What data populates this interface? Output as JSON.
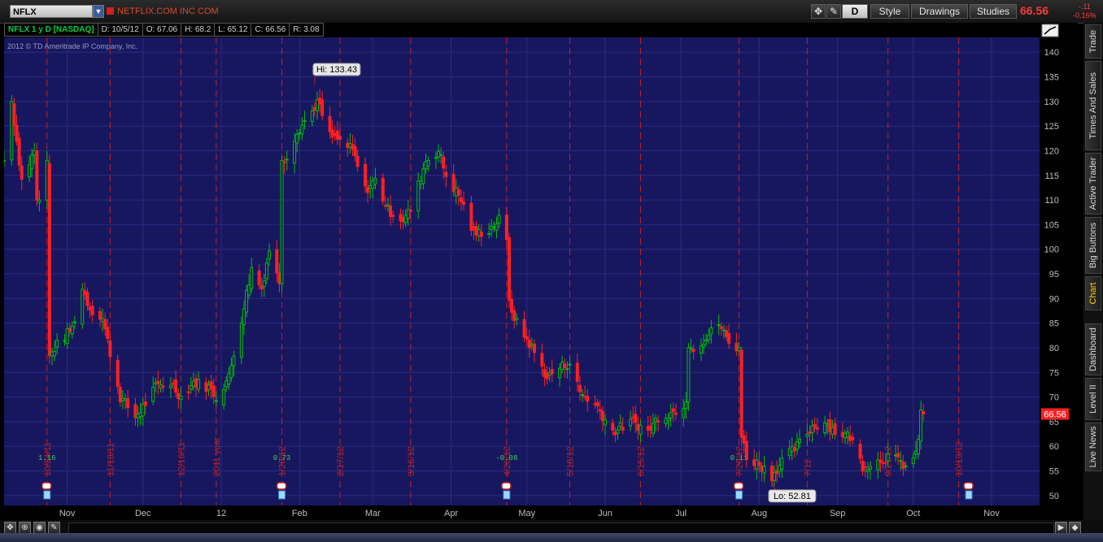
{
  "header": {
    "symbol": "NFLX",
    "company": "NETFLIX.COM INC COM",
    "period_button": "D",
    "style_label": "Style",
    "drawings_label": "Drawings",
    "studies_label": "Studies",
    "last_price": "66.56",
    "net_change": "-.11",
    "pct_change": "-0.16%"
  },
  "info_bar": {
    "title": "NFLX 1 y D [NASDAQ]",
    "date": "D: 10/5/12",
    "open": "O: 67.06",
    "high": "H: 68.2",
    "low": "L: 65.12",
    "close": "C: 66.56",
    "range": "R: 3.08"
  },
  "copyright": "2012 © TD Ameritrade IP Company, Inc.",
  "side_tabs": [
    "Trade",
    "Times And Sales",
    "Active Trader",
    "Big Buttons",
    "Chart",
    "Dashboard",
    "Level II",
    "Live News"
  ],
  "colors": {
    "background": "#171760",
    "grid": "#2b2b80",
    "up_candle": "#00c000",
    "down_candle": "#ff2020",
    "event_line": "#c02020",
    "price_tag_bg": "#ff2020",
    "accent": "#ffcc00"
  },
  "chart_data": {
    "type": "candlestick",
    "title": "NFLX 1 y D [NASDAQ]",
    "ylim": [
      48,
      143
    ],
    "y_ticks": [
      50,
      55,
      60,
      65,
      70,
      75,
      80,
      85,
      90,
      95,
      100,
      105,
      110,
      115,
      120,
      125,
      130,
      135,
      140
    ],
    "x_range": [
      "2011-10-07",
      "2012-11-20"
    ],
    "x_ticks": [
      {
        "date": "2011-11-01",
        "label": "Nov"
      },
      {
        "date": "2011-12-01",
        "label": "Dec"
      },
      {
        "date": "2012-01-01",
        "label": "12"
      },
      {
        "date": "2012-02-01",
        "label": "Feb"
      },
      {
        "date": "2012-03-01",
        "label": "Mar"
      },
      {
        "date": "2012-04-01",
        "label": "Apr"
      },
      {
        "date": "2012-05-01",
        "label": "May"
      },
      {
        "date": "2012-06-01",
        "label": "Jun"
      },
      {
        "date": "2012-07-01",
        "label": "Jul"
      },
      {
        "date": "2012-08-01",
        "label": "Aug"
      },
      {
        "date": "2012-09-01",
        "label": "Sep"
      },
      {
        "date": "2012-10-01",
        "label": "Oct"
      },
      {
        "date": "2012-11-01",
        "label": "Nov"
      }
    ],
    "price_path": [
      {
        "date": "2011-10-07",
        "close": 118
      },
      {
        "date": "2011-10-10",
        "close": 130
      },
      {
        "date": "2011-10-14",
        "close": 114
      },
      {
        "date": "2011-10-19",
        "close": 120
      },
      {
        "date": "2011-10-21",
        "close": 110
      },
      {
        "date": "2011-10-24",
        "close": 118
      },
      {
        "date": "2011-10-25",
        "close": 78
      },
      {
        "date": "2011-10-27",
        "close": 80
      },
      {
        "date": "2011-11-03",
        "close": 84
      },
      {
        "date": "2011-11-07",
        "close": 92
      },
      {
        "date": "2011-11-10",
        "close": 88
      },
      {
        "date": "2011-11-15",
        "close": 86
      },
      {
        "date": "2011-11-18",
        "close": 79
      },
      {
        "date": "2011-11-22",
        "close": 70
      },
      {
        "date": "2011-11-28",
        "close": 66
      },
      {
        "date": "2011-12-01",
        "close": 68
      },
      {
        "date": "2011-12-06",
        "close": 72
      },
      {
        "date": "2011-12-12",
        "close": 73
      },
      {
        "date": "2011-12-16",
        "close": 70
      },
      {
        "date": "2011-12-21",
        "close": 73
      },
      {
        "date": "2011-12-27",
        "close": 72
      },
      {
        "date": "2011-12-30",
        "close": 70
      },
      {
        "date": "2012-01-04",
        "close": 74
      },
      {
        "date": "2012-01-09",
        "close": 86
      },
      {
        "date": "2012-01-13",
        "close": 96
      },
      {
        "date": "2012-01-17",
        "close": 92
      },
      {
        "date": "2012-01-20",
        "close": 100
      },
      {
        "date": "2012-01-24",
        "close": 93
      },
      {
        "date": "2012-01-26",
        "close": 118
      },
      {
        "date": "2012-01-31",
        "close": 124
      },
      {
        "date": "2012-02-06",
        "close": 128
      },
      {
        "date": "2012-02-08",
        "close": 130
      },
      {
        "date": "2012-02-13",
        "close": 123
      },
      {
        "date": "2012-02-17",
        "close": 122
      },
      {
        "date": "2012-02-22",
        "close": 120
      },
      {
        "date": "2012-02-27",
        "close": 112
      },
      {
        "date": "2012-03-02",
        "close": 114
      },
      {
        "date": "2012-03-07",
        "close": 108
      },
      {
        "date": "2012-03-13",
        "close": 106
      },
      {
        "date": "2012-03-16",
        "close": 108
      },
      {
        "date": "2012-03-22",
        "close": 118
      },
      {
        "date": "2012-03-27",
        "close": 120
      },
      {
        "date": "2012-03-30",
        "close": 115
      },
      {
        "date": "2012-04-05",
        "close": 110
      },
      {
        "date": "2012-04-10",
        "close": 103
      },
      {
        "date": "2012-04-16",
        "close": 104
      },
      {
        "date": "2012-04-20",
        "close": 106
      },
      {
        "date": "2012-04-23",
        "close": 102
      },
      {
        "date": "2012-04-24",
        "close": 89
      },
      {
        "date": "2012-04-27",
        "close": 85
      },
      {
        "date": "2012-05-03",
        "close": 80
      },
      {
        "date": "2012-05-09",
        "close": 74
      },
      {
        "date": "2012-05-14",
        "close": 76
      },
      {
        "date": "2012-05-18",
        "close": 77
      },
      {
        "date": "2012-05-22",
        "close": 71
      },
      {
        "date": "2012-05-29",
        "close": 68
      },
      {
        "date": "2012-06-04",
        "close": 63
      },
      {
        "date": "2012-06-08",
        "close": 64
      },
      {
        "date": "2012-06-12",
        "close": 65
      },
      {
        "date": "2012-06-18",
        "close": 63
      },
      {
        "date": "2012-06-22",
        "close": 66
      },
      {
        "date": "2012-06-28",
        "close": 67
      },
      {
        "date": "2012-07-03",
        "close": 69
      },
      {
        "date": "2012-07-06",
        "close": 80
      },
      {
        "date": "2012-07-11",
        "close": 82
      },
      {
        "date": "2012-07-16",
        "close": 85
      },
      {
        "date": "2012-07-20",
        "close": 81
      },
      {
        "date": "2012-07-24",
        "close": 80
      },
      {
        "date": "2012-07-25",
        "close": 62
      },
      {
        "date": "2012-07-27",
        "close": 58
      },
      {
        "date": "2012-08-02",
        "close": 56
      },
      {
        "date": "2012-08-06",
        "close": 54
      },
      {
        "date": "2012-08-10",
        "close": 57
      },
      {
        "date": "2012-08-16",
        "close": 60
      },
      {
        "date": "2012-08-22",
        "close": 64
      },
      {
        "date": "2012-08-27",
        "close": 65
      },
      {
        "date": "2012-08-31",
        "close": 63
      },
      {
        "date": "2012-09-06",
        "close": 62
      },
      {
        "date": "2012-09-11",
        "close": 56
      },
      {
        "date": "2012-09-17",
        "close": 57
      },
      {
        "date": "2012-09-21",
        "close": 58
      },
      {
        "date": "2012-09-25",
        "close": 57
      },
      {
        "date": "2012-09-28",
        "close": 56
      },
      {
        "date": "2012-10-02",
        "close": 58
      },
      {
        "date": "2012-10-03",
        "close": 62
      },
      {
        "date": "2012-10-04",
        "close": 67
      },
      {
        "date": "2012-10-05",
        "close": 66.56
      }
    ],
    "annotations": {
      "high": {
        "text": "Hi: 133.43",
        "date": "2012-02-07",
        "value": 133.43
      },
      "low": {
        "text": "Lo: 52.81",
        "date": "2012-08-06",
        "value": 52.81
      },
      "last": {
        "text": "66.56",
        "value": 66.56
      }
    },
    "event_markers": [
      {
        "date": "2011-10-24",
        "label": "10/24/11",
        "value_text": "1.16"
      },
      {
        "date": "2011-11-18",
        "label": "11/18/11"
      },
      {
        "date": "2011-12-16",
        "label": "12/16/11"
      },
      {
        "date": "2011-12-30",
        "label": "2011 year"
      },
      {
        "date": "2012-01-25",
        "label": "1/20/12",
        "value_text": "0.73"
      },
      {
        "date": "2012-02-17",
        "label": "2/17/12"
      },
      {
        "date": "2012-03-16",
        "label": "3/16/12"
      },
      {
        "date": "2012-04-23",
        "label": "4/20/12",
        "value_text": "-0.08"
      },
      {
        "date": "2012-05-18",
        "label": "5/18/12"
      },
      {
        "date": "2012-06-15",
        "label": "6/15/12"
      },
      {
        "date": "2012-07-24",
        "label": "7/20/12",
        "value_text": "0.11"
      },
      {
        "date": "2012-08-20",
        "label": "7/12"
      },
      {
        "date": "2012-09-21",
        "label": "9/21/12"
      },
      {
        "date": "2012-10-19",
        "label": "10/19/12"
      }
    ],
    "earnings_dates": [
      "2011-10-24",
      "2012-01-25",
      "2012-04-23",
      "2012-07-24",
      "2012-10-23"
    ]
  }
}
